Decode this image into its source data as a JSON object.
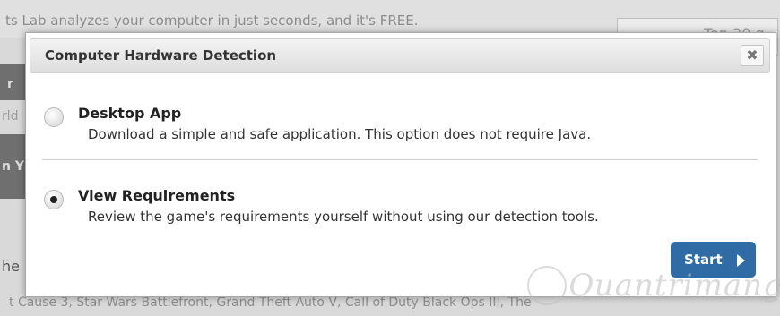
{
  "background": {
    "tagline": "ts Lab analyzes your computer in just seconds, and it's FREE.",
    "tab_text": "Top 20 g",
    "left_fragments": [
      "r",
      "rld",
      "n Y",
      "he"
    ],
    "bottom_line": "t Cause 3, Star Wars Battlefront, Grand Theft Auto V, Call of Duty Black Ops III, The"
  },
  "dialog": {
    "title": "Computer Hardware Detection",
    "close_symbol": "✖",
    "options": [
      {
        "title": "Desktop App",
        "description": "Download a simple and safe application. This option does not require Java.",
        "selected": false
      },
      {
        "title": "View Requirements",
        "description": "Review the game's requirements yourself without using our detection tools.",
        "selected": true
      }
    ],
    "start_label": "Start"
  },
  "watermark": "Quantrimang",
  "colors": {
    "accent": "#2f6ca6"
  }
}
